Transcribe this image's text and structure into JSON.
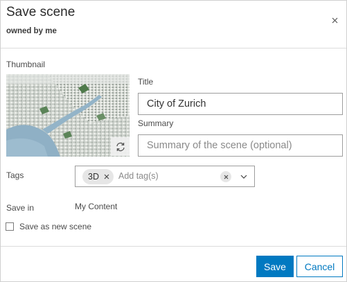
{
  "dialog": {
    "title": "Save scene",
    "subtitle": "owned by me",
    "close_icon": "close-icon"
  },
  "thumbnail": {
    "label": "Thumbnail",
    "refresh_icon": "refresh-icon"
  },
  "title_field": {
    "label": "Title",
    "value": "City of Zurich"
  },
  "summary_field": {
    "label": "Summary",
    "placeholder": "Summary of the scene (optional)"
  },
  "tags": {
    "label": "Tags",
    "chips": [
      "3D"
    ],
    "placeholder": "Add tag(s)"
  },
  "save_in": {
    "label": "Save in",
    "value": "My Content"
  },
  "save_as_new": {
    "label": "Save as new scene",
    "checked": false
  },
  "buttons": {
    "save": "Save",
    "cancel": "Cancel"
  },
  "colors": {
    "accent": "#0079c1",
    "border": "#9d9d9d"
  }
}
